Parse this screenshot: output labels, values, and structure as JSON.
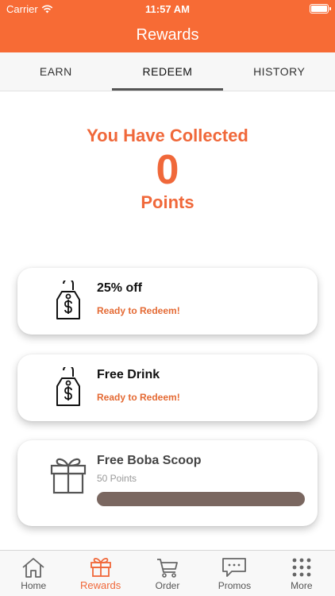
{
  "status_bar": {
    "carrier": "Carrier",
    "time": "11:57 AM"
  },
  "nav": {
    "title": "Rewards"
  },
  "tabs": [
    {
      "label": "EARN"
    },
    {
      "label": "REDEEM"
    },
    {
      "label": "HISTORY"
    }
  ],
  "collected": {
    "heading": "You Have Collected",
    "value": "0",
    "unit": "Points"
  },
  "rewards": [
    {
      "title": "25% off",
      "status": "Ready to Redeem!",
      "icon": "price-tag-icon"
    },
    {
      "title": "Free Drink",
      "status": "Ready to Redeem!",
      "icon": "price-tag-icon"
    },
    {
      "title": "Free Boba Scoop",
      "points": "50 Points",
      "icon": "gift-icon",
      "progress": 0
    }
  ],
  "tab_bar": [
    {
      "label": "Home",
      "icon": "home-icon"
    },
    {
      "label": "Rewards",
      "icon": "gift-icon"
    },
    {
      "label": "Order",
      "icon": "cart-icon"
    },
    {
      "label": "Promos",
      "icon": "chat-bubble-icon"
    },
    {
      "label": "More",
      "icon": "grid-dots-icon"
    }
  ],
  "colors": {
    "brand": "#f76b35",
    "accent_text": "#f0683a",
    "progress_bar": "#7a6760"
  }
}
